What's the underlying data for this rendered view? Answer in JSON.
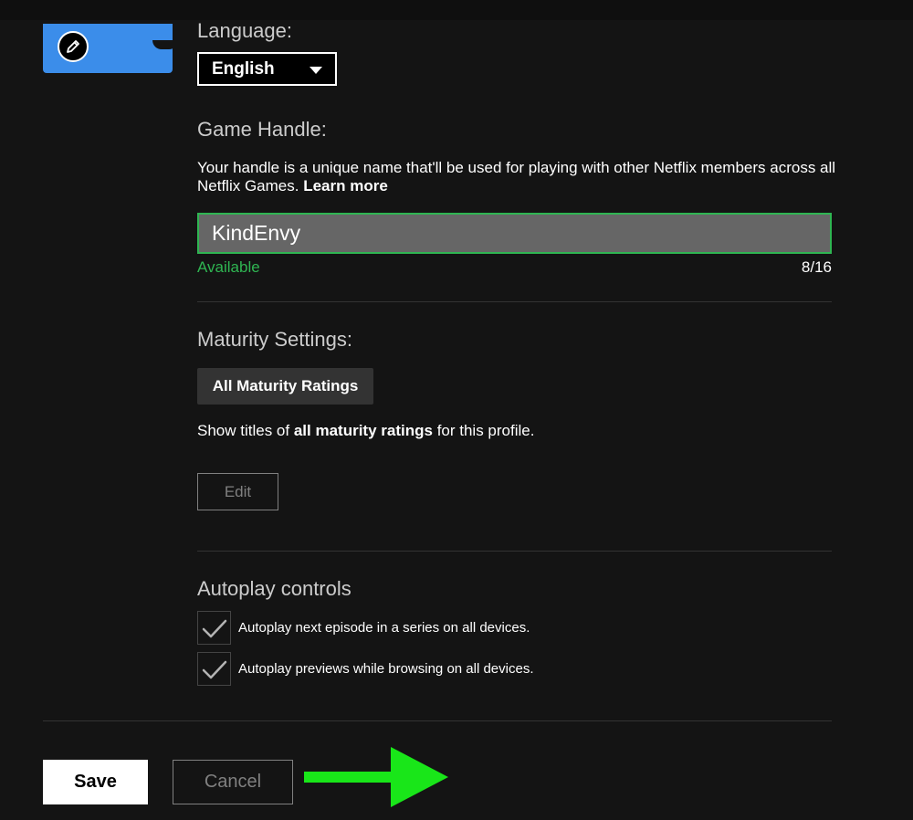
{
  "profile": {
    "edit_icon": "pencil-icon",
    "avatar_color": "#3b8dea"
  },
  "language": {
    "label": "Language:",
    "selected": "English"
  },
  "game_handle": {
    "label": "Game Handle:",
    "description": "Your handle is a unique name that'll be used for playing with other Netflix members across all Netflix Games.",
    "learn_more": "Learn more",
    "value": "KindEnvy",
    "status": "Available",
    "counter": "8/16",
    "status_color": "#2fb552"
  },
  "maturity": {
    "label": "Maturity Settings:",
    "badge": "All Maturity Ratings",
    "desc_prefix": "Show titles of",
    "desc_bold": "all maturity ratings",
    "desc_suffix": "for this profile.",
    "edit_label": "Edit"
  },
  "autoplay": {
    "label": "Autoplay controls",
    "items": [
      {
        "label": "Autoplay next episode in a series on all devices.",
        "checked": true
      },
      {
        "label": "Autoplay previews while browsing on all devices.",
        "checked": true
      }
    ]
  },
  "actions": {
    "save_label": "Save",
    "cancel_label": "Cancel"
  },
  "annotation": {
    "arrow_icon": "right-arrow-icon",
    "arrow_color": "#19e619"
  }
}
